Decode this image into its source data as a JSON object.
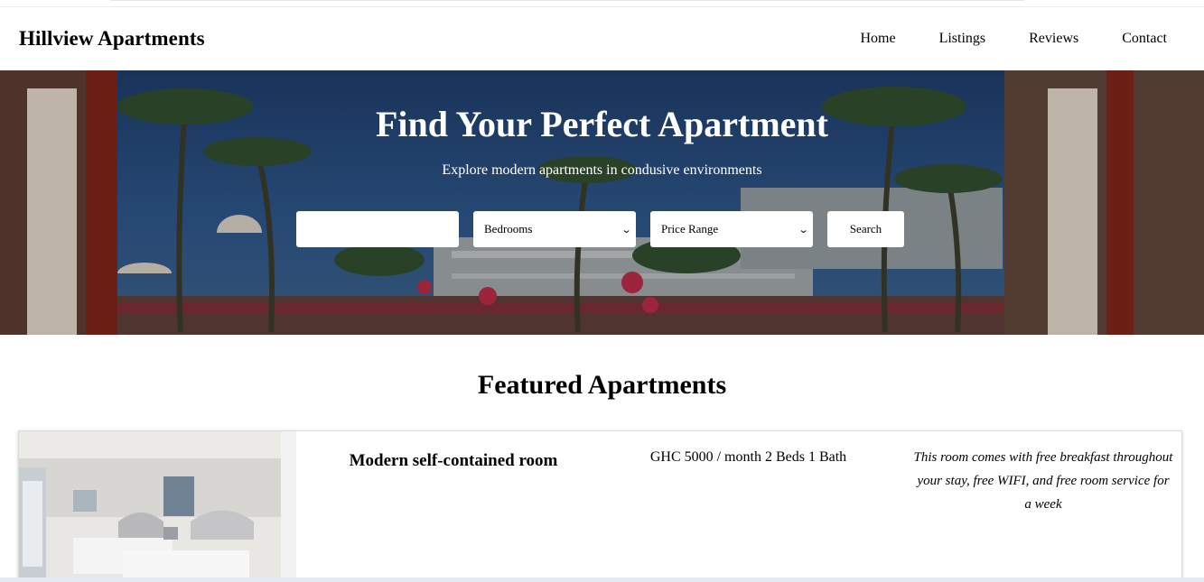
{
  "header": {
    "brand": "Hillview Apartments",
    "nav": [
      "Home",
      "Listings",
      "Reviews",
      "Contact"
    ]
  },
  "hero": {
    "title": "Find Your Perfect Apartment",
    "subtitle": "Explore modern apartments in condusive environments",
    "search": {
      "text_value": "",
      "bedrooms_selected": "Bedrooms",
      "price_selected": "Price Range",
      "button_label": "Search"
    }
  },
  "featured": {
    "title": "Featured Apartments",
    "cards": [
      {
        "name": "Modern self-contained room",
        "price": "GHC 5000 / month 2 Beds 1 Bath",
        "description": "This room comes with free breakfast throughout your stay, free WIFI, and free room service for a week"
      }
    ]
  }
}
